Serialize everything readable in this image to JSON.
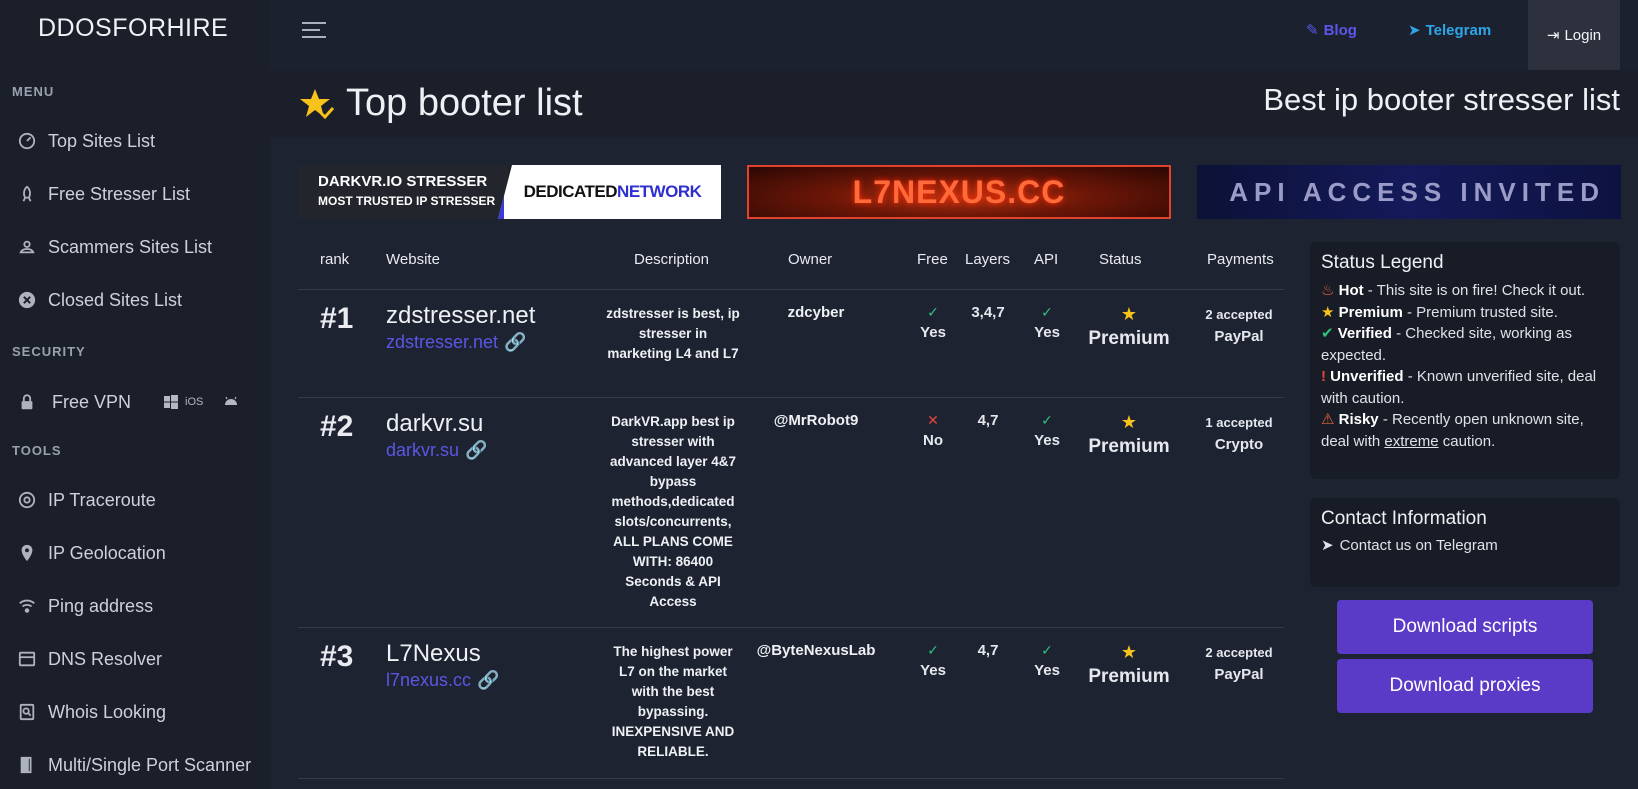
{
  "brand": "DDOSFORHIRE",
  "sidebar": {
    "menu_label": "MENU",
    "security_label": "SECURITY",
    "tools_label": "TOOLS",
    "menu_items": [
      {
        "label": "Top Sites List",
        "icon": "gauge-icon"
      },
      {
        "label": "Free Stresser List",
        "icon": "rocket-icon"
      },
      {
        "label": "Scammers Sites List",
        "icon": "scammer-icon"
      },
      {
        "label": "Closed Sites List",
        "icon": "close-circle-icon"
      }
    ],
    "vpn": {
      "label": "Free VPN",
      "ios": "iOS"
    },
    "tools_items": [
      {
        "label": "IP Traceroute",
        "icon": "traceroute-icon"
      },
      {
        "label": "IP Geolocation",
        "icon": "pin-icon"
      },
      {
        "label": "Ping address",
        "icon": "wifi-icon"
      },
      {
        "label": "DNS Resolver",
        "icon": "dns-icon"
      },
      {
        "label": "Whois Looking",
        "icon": "search-doc-icon"
      },
      {
        "label": "Multi/Single Port Scanner",
        "icon": "door-icon"
      }
    ]
  },
  "topbar": {
    "blog": "Blog",
    "telegram": "Telegram",
    "login": "Login"
  },
  "page": {
    "title": "Top booter list",
    "subtitle": "Best ip booter stresser list"
  },
  "banners": {
    "b1_line1": "DARKVR.IO STRESSER",
    "b1_line2": "MOST TRUSTED IP STRESSER",
    "b1_right_a": "DEDICATED",
    "b1_right_b": "NETWORK",
    "b2": "L7NEXUS.CC",
    "b3": "API ACCESS INVITED"
  },
  "table": {
    "headers": {
      "rank": "rank",
      "website": "Website",
      "description": "Description",
      "owner": "Owner",
      "free": "Free",
      "layers": "Layers",
      "api": "API",
      "status": "Status",
      "payments": "Payments"
    },
    "rows": [
      {
        "rank": "#1",
        "name": "zdstresser.net",
        "link": "zdstresser.net",
        "description": "zdstresser is best, ip stresser in marketing L4 and L7",
        "owner": "zdcyber",
        "free": "Yes",
        "layers": "3,4,7",
        "api": "Yes",
        "status": "Premium",
        "pay_count": "2 accepted",
        "pay_method": "PayPal"
      },
      {
        "rank": "#2",
        "name": "darkvr.su",
        "link": "darkvr.su",
        "description": "DarkVR.app best ip stresser with advanced layer 4&7 bypass methods,dedicated slots/concurrents, ALL PLANS COME WITH: 86400 Seconds & API Access",
        "owner": "@MrRobot9",
        "free": "No",
        "layers": "4,7",
        "api": "Yes",
        "status": "Premium",
        "pay_count": "1 accepted",
        "pay_method": "Crypto"
      },
      {
        "rank": "#3",
        "name": "L7Nexus",
        "link": "l7nexus.cc",
        "description": "The highest power L7 on the market with the best bypassing. INEXPENSIVE AND RELIABLE.",
        "owner": "@ByteNexusLab",
        "free": "Yes",
        "layers": "4,7",
        "api": "Yes",
        "status": "Premium",
        "pay_count": "2 accepted",
        "pay_method": "PayPal"
      }
    ]
  },
  "legend": {
    "title": "Status Legend",
    "hot_label": "Hot",
    "hot_text": " - This site is on fire! Check it out.",
    "premium_label": "Premium",
    "premium_text": " - Premium trusted site.",
    "verified_label": "Verified",
    "verified_text": " - Checked site, working as expected.",
    "unverified_label": "Unverified",
    "unverified_text": " - Known unverified site, deal with caution.",
    "risky_label": "Risky",
    "risky_text_a": " - Recently open unknown site, deal with ",
    "risky_em": "extreme",
    "risky_text_b": " caution."
  },
  "contact": {
    "title": "Contact Information",
    "link": "Contact us on Telegram"
  },
  "buttons": {
    "scripts": "Download scripts",
    "proxies": "Download proxies"
  },
  "colors": {
    "accent": "#5a3bc7",
    "link": "#5a56e3",
    "telegram": "#2ea6e8",
    "star": "#f7c21c",
    "ok": "#2ec27e",
    "no": "#e2473b"
  }
}
